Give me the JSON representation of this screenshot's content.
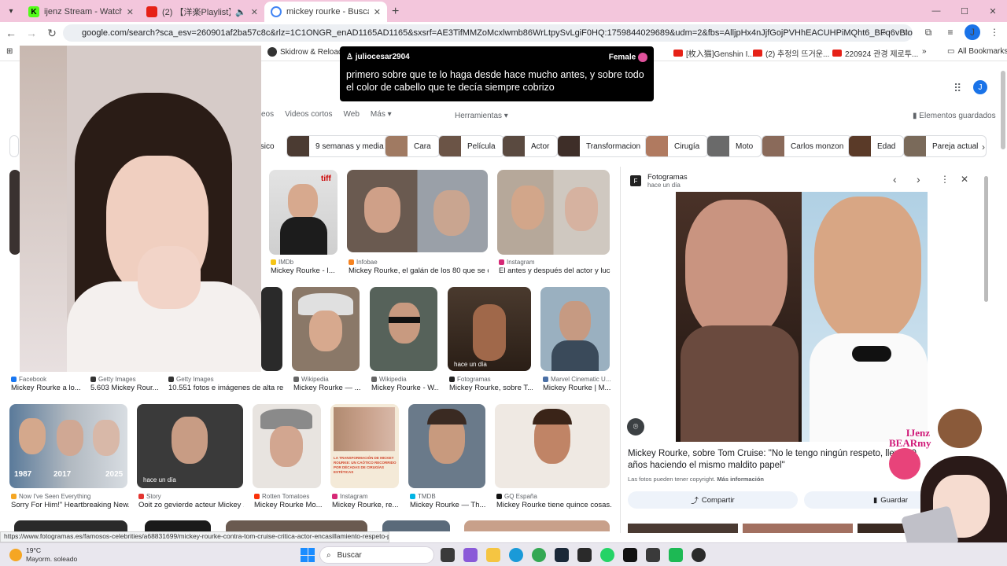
{
  "browser": {
    "tabs": [
      {
        "title": "ijenz Stream - Watch Live on Ki",
        "fav_color": "#53fc18"
      },
      {
        "title": "(2) 【洋楽Playlist】最強にオシャ",
        "fav_color": "#e62117"
      },
      {
        "title": "mickey rourke - Buscar con Goo",
        "fav_color": "#4285f4"
      }
    ],
    "new_tab": "+",
    "url": "google.com/search?sca_esv=260901af2ba57c8c&rlz=1C1ONGR_enAD1165AD1165&sxsrf=AE3TifMMZoMcxlwmb86WrLtpySvLgiF0HQ:1759844029689&udm=2&fbs=AlljpHx4nJjfGojPVHhEACUHPiMQht6_BFq6vBIoFFRK7qchKHDX9TtpZ992kyQp...",
    "avatar_letter": "J",
    "bookmarks": [
      {
        "label": "Skidrow & Reloade...",
        "type": "ic"
      },
      {
        "label": "[枚入猫]Genshin I...",
        "type": "yt"
      },
      {
        "label": "(2) 추정의 뜨거운...",
        "type": "yt"
      },
      {
        "label": "220924 관경 제로투...",
        "type": "yt"
      }
    ],
    "more_bookmarks": "»",
    "all_bookmarks": "All Bookmarks"
  },
  "chat": {
    "user": "juliocesar2904",
    "gender": "Female",
    "message": "primero sobre que te lo haga desde hace mucho antes, y sobre todo el color de cabello que te decía siempre cobrizo"
  },
  "google": {
    "nav": [
      "eos",
      "Videos cortos",
      "Web",
      "Más"
    ],
    "tools": "Herramientas",
    "saved": "Elementos guardados",
    "avatar_letter": "J",
    "chips": [
      {
        "label": "ísico",
        "color": "#8a7a6b"
      },
      {
        "label": "9 semanas y media",
        "color": "#4b3b32"
      },
      {
        "label": "Cara",
        "color": "#a07a62"
      },
      {
        "label": "Película",
        "color": "#6b5446"
      },
      {
        "label": "Actor",
        "color": "#5a4a40"
      },
      {
        "label": "Transformacion",
        "color": "#3e2e28"
      },
      {
        "label": "Cirugía",
        "color": "#b07a60"
      },
      {
        "label": "Moto",
        "color": "#6a6a6a"
      },
      {
        "label": "Carlos monzon",
        "color": "#8a6a5a"
      },
      {
        "label": "Edad",
        "color": "#5a3a28"
      },
      {
        "label": "Pareja actual",
        "color": "#7a6a5a"
      }
    ],
    "results_row1": [
      {
        "source": "IMDb",
        "caption": "Mickey Rourke - I...",
        "src_color": "#f5c518"
      },
      {
        "source": "Infobae",
        "caption": "Mickey Rourke, el galán de los 80 que se c...",
        "src_color": "#f58220"
      },
      {
        "source": "Instagram",
        "caption": "El antes y después del actor y luc...",
        "src_color": "#d62976"
      }
    ],
    "results_row2": [
      {
        "source": "Facebook",
        "caption": "Mickey Rourke a lo...",
        "src_color": "#1877f2"
      },
      {
        "source": "Getty Images",
        "caption": "5.603 Mickey Rour...",
        "src_color": "#333333"
      },
      {
        "source": "Getty Images",
        "caption": "10.551 fotos e imágenes de alta re...",
        "src_color": "#333333"
      },
      {
        "source": "Wikipedia",
        "caption": "Mickey Rourke — ...",
        "src_color": "#666666"
      },
      {
        "source": "Wikipedia",
        "caption": "Mickey Rourke - W...",
        "src_color": "#666666"
      },
      {
        "source": "Fotogramas",
        "caption": "Mickey Rourke, sobre T...",
        "src_color": "#222222"
      },
      {
        "source": "Marvel Cinematic U...",
        "caption": "Mickey Rourke | M...",
        "src_color": "#4a6fa5"
      }
    ],
    "results_row3": [
      {
        "source": "Now I've Seen Everything",
        "caption": "Sorry For Him!\" Heartbreaking New...",
        "src_color": "#f5a623"
      },
      {
        "source": "Story",
        "caption": "Ooit zo gevierde acteur Mickey ...",
        "src_color": "#e3342f"
      },
      {
        "source": "Rotten Tomatoes",
        "caption": "Mickey Rourke Mo...",
        "src_color": "#fa320a"
      },
      {
        "source": "Instagram",
        "caption": "Mickey Rourke, re...",
        "src_color": "#d62976"
      },
      {
        "source": "TMDB",
        "caption": "Mickey Rourke — Th...",
        "src_color": "#01b4e4"
      },
      {
        "source": "GQ España",
        "caption": "Mickey Rourke tiene quince cosas...",
        "src_color": "#111111"
      }
    ],
    "hace_un_dia": "hace un día",
    "year_labels": [
      "1987",
      "2017",
      "2025"
    ],
    "article_title": "LA TRANSFORMACIÓN DE MICKEY ROURKE: UN CAÓTICO RECORRIDO POR DÉCADAS DE CIRUGÍAS ESTÉTICAS"
  },
  "panel": {
    "source": "Fotogramas",
    "time": "hace un día",
    "title": "Mickey Rourke, sobre Tom Cruise: \"No le tengo ningún respeto, lleva 30 años haciendo el mismo maldito papel\"",
    "copyright": "Las fotos pueden tener copyright.",
    "more_info": "Más información",
    "share": "Compartir",
    "save": "Guardar"
  },
  "status_url": "https://www.fotogramas.es/famosos-celebrities/a68831699/mickey-rourke-contra-tom-cruise-critica-actor-encasillamiento-respeto-papel/",
  "overlay": {
    "brand": "IJenz BEARmy"
  },
  "taskbar": {
    "temp": "19°C",
    "weather": "Mayorm. soleado",
    "search": "Buscar"
  }
}
